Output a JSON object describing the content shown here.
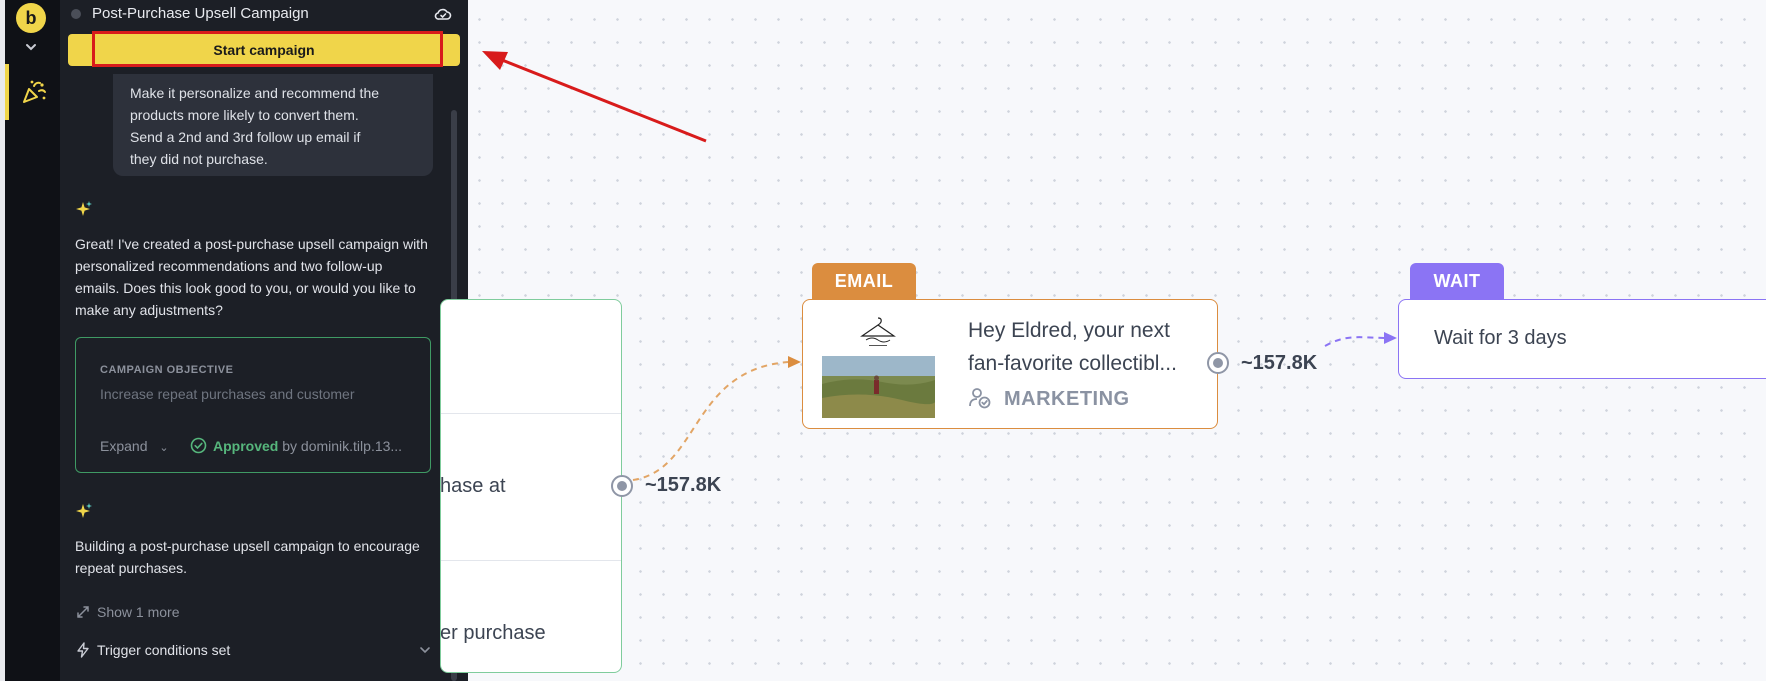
{
  "app": {
    "logo_letter": "b",
    "brand_color": "#f0d54a"
  },
  "panel": {
    "campaign_title": "Post-Purchase Upsell Campaign",
    "start_button": "Start campaign",
    "user_message_lines": [
      "Make it personalize and recommend the",
      "products more likely to convert them.",
      "Send a 2nd and 3rd follow up email if",
      "they did not purchase."
    ],
    "ai_message_1": "Great! I've created a post-purchase upsell campaign with personalized recommendations and two follow-up emails. Does this look good to you, or would you like to make any adjustments?",
    "objective": {
      "label": "CAMPAIGN OBJECTIVE",
      "text": "Increase repeat purchases and customer",
      "expand_label": "Expand",
      "approved_word": "Approved",
      "approved_by": "by dominik.tilp.13..."
    },
    "ai_message_2": "Building a post-purchase upsell campaign to encourage repeat purchases.",
    "show_more": "Show 1 more",
    "trigger_conditions": "Trigger conditions set"
  },
  "canvas": {
    "trigger_node": {
      "row_text_1": "hase at",
      "row_text_2": "er purchase",
      "audience_count": "~157.8K"
    },
    "email_node": {
      "tab_label": "EMAIL",
      "subject_line_1": "Hey Eldred, your next",
      "subject_line_2": "fan-favorite collectibl...",
      "type_label": "MARKETING",
      "audience_count": "~157.8K",
      "accent_color": "#db8d3f"
    },
    "wait_node": {
      "tab_label": "WAIT",
      "text": "Wait for 3 days",
      "accent_color": "#8b74f4"
    }
  },
  "annotation": {
    "highlight_color": "#d81b1b"
  }
}
